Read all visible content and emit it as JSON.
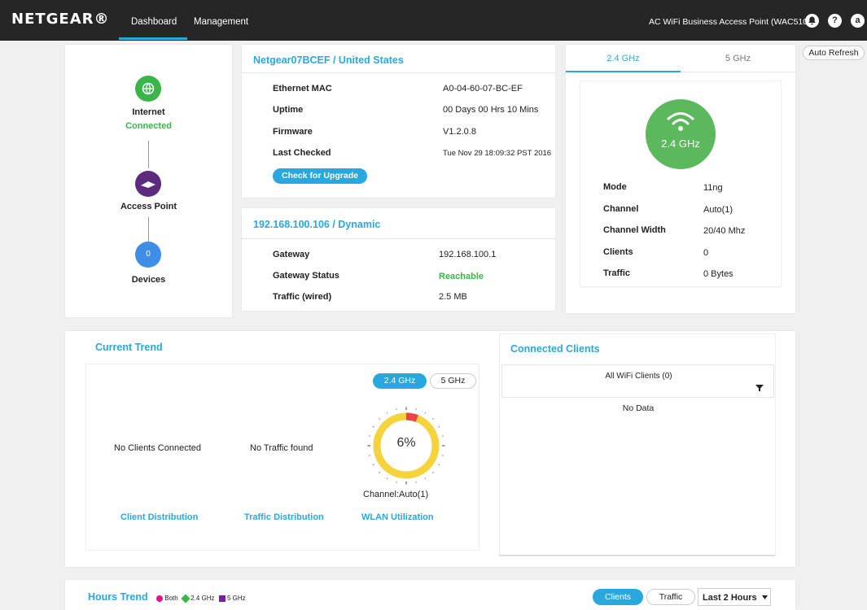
{
  "header": {
    "logo": "NETGEAR®",
    "tabs": [
      "Dashboard",
      "Management"
    ],
    "device_name": "AC WiFi Business Access Point (WAC510)",
    "help_symbol": "?",
    "user_initial": "a"
  },
  "auto_refresh": "Auto Refresh",
  "topology": {
    "internet_label": "Internet",
    "internet_status": "Connected",
    "access_point_label": "Access Point",
    "devices_count": "0",
    "devices_label": "Devices"
  },
  "device_info": {
    "title": "Netgear07BCEF / United States",
    "rows": [
      {
        "label": "Ethernet MAC",
        "value": "A0-04-60-07-BC-EF"
      },
      {
        "label": "Uptime",
        "value": "00 Days 00 Hrs 10 Mins"
      },
      {
        "label": "Firmware",
        "value": "V1.2.0.8"
      },
      {
        "label": "Last Checked",
        "value": "Tue Nov 29 18:09:32 PST 2016"
      }
    ],
    "upgrade_button": "Check for Upgrade"
  },
  "ip_info": {
    "title": "192.168.100.106 / Dynamic",
    "rows": [
      {
        "label": "Gateway",
        "value": "192.168.100.1"
      },
      {
        "label": "Gateway Status",
        "value": "Reachable"
      },
      {
        "label": "Traffic (wired)",
        "value": "2.5 MB"
      }
    ]
  },
  "radio": {
    "tabs": [
      "2.4 GHz",
      "5 GHz"
    ],
    "badge": "2.4 GHz",
    "rows": [
      {
        "label": "Mode",
        "value": "11ng"
      },
      {
        "label": "Channel",
        "value": "Auto(1)"
      },
      {
        "label": "Channel Width",
        "value": "20/40 Mhz"
      },
      {
        "label": "Clients",
        "value": "0"
      },
      {
        "label": "Traffic",
        "value": "0 Bytes"
      }
    ]
  },
  "current_trend": {
    "title": "Current Trend",
    "no_clients": "No Clients Connected",
    "no_traffic": "No Traffic found",
    "band_tabs": [
      "2.4 GHz",
      "5 GHz"
    ],
    "utilization_percent": 6,
    "utilization_text": "6%",
    "channel_text": "Channel:Auto(1)",
    "links": [
      "Client Distribution",
      "Traffic Distribution",
      "WLAN Utilization"
    ]
  },
  "connected_clients": {
    "title": "Connected Clients",
    "filter_label": "All WiFi Clients (0)",
    "no_data": "No Data"
  },
  "hours_trend": {
    "title": "Hours Trend",
    "legend": [
      {
        "label": "Both",
        "color": "#e0138c"
      },
      {
        "label": "2.4 GHz",
        "color": "#3ab54a"
      },
      {
        "label": "5 GHz",
        "color": "#7b1fa2"
      }
    ],
    "toggle": [
      "Clients",
      "Traffic"
    ],
    "range_select": "Last 2 Hours"
  },
  "colors": {
    "accent": "#29a8e0",
    "ok": "#3ab54a",
    "gauge_used": "#e84545",
    "gauge_free": "#f5d33c"
  }
}
